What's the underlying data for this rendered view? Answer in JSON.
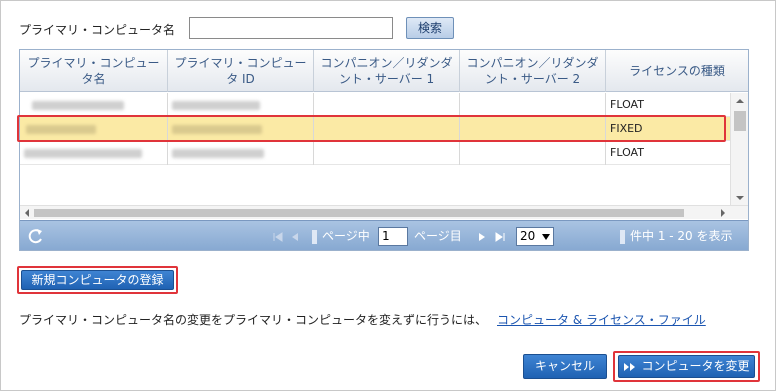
{
  "search": {
    "label": "プライマリ・コンピュータ名",
    "value": "",
    "button": "検索"
  },
  "table": {
    "columns": [
      "プライマリ・コンピュータ名",
      "プライマリ・コンピュータ ID",
      "コンパニオン／リダンダント・サーバー 1",
      "コンパニオン／リダンダント・サーバー 2",
      "ライセンスの種類"
    ],
    "rows": [
      {
        "license": "FLOAT",
        "selected": false
      },
      {
        "license": "FIXED",
        "selected": true
      },
      {
        "license": "FLOAT",
        "selected": false
      }
    ]
  },
  "pager": {
    "page_prefix": "ページ中",
    "page_value": "1",
    "page_suffix": "ページ目",
    "page_size": "20",
    "range_text": "件中 1 - 20 を表示"
  },
  "actions": {
    "new_computer": "新規コンピュータの登録",
    "note": "プライマリ・コンピュータ名の変更をプライマリ・コンピュータを変えずに行うには、",
    "note_link": "コンピュータ & ライセンス・ファイル",
    "cancel": "キャンセル",
    "change": "コンピュータを変更"
  }
}
